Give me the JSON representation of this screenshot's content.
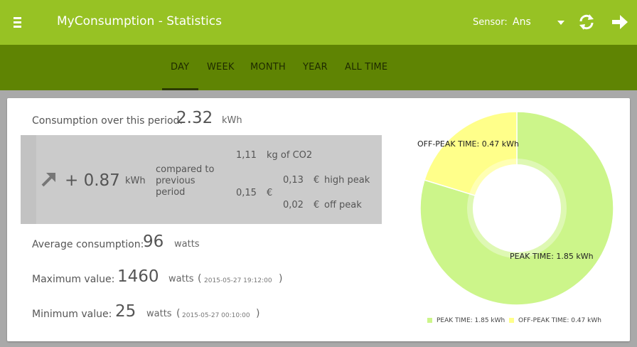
{
  "app": {
    "title": "MyConsumption - Statistics"
  },
  "header": {
    "sensor_label": "Sensor:",
    "sensor_value": "Ans"
  },
  "icons": {
    "menu": "menu-icon",
    "refresh": "refresh-icon",
    "forward": "forward-arrow-icon",
    "trend": "trend-up-arrow-icon"
  },
  "tabs": [
    {
      "label": "DAY",
      "active": true
    },
    {
      "label": "WEEK",
      "active": false
    },
    {
      "label": "MONTH",
      "active": false
    },
    {
      "label": "YEAR",
      "active": false
    },
    {
      "label": "ALL TIME",
      "active": false
    }
  ],
  "stats": {
    "consumption": {
      "label": "Consumption over this period:",
      "value": "2.32",
      "unit": "kWh"
    },
    "comparison": {
      "delta": "+ 0.87",
      "delta_unit": "kWh",
      "compared_line1": "compared to",
      "compared_line2": "previous",
      "compared_line3": "period",
      "co2_value": "1,11",
      "co2_unit": "kg of CO2",
      "cost_total": "0,15",
      "cost_currency": "€",
      "high_peak_value": "0,13",
      "high_peak_currency": "€",
      "high_peak_label": "high peak",
      "off_peak_value": "0,02",
      "off_peak_currency": "€",
      "off_peak_label": "off peak"
    },
    "average": {
      "label": "Average consumption:",
      "value": "96",
      "unit": "watts"
    },
    "maximum": {
      "label": "Maximum value:",
      "value": "1460",
      "unit": "watts",
      "timestamp": "2015-05-27 19:12:00"
    },
    "minimum": {
      "label": "Minimum value:",
      "value": "25",
      "unit": "watts",
      "timestamp": "2015-05-27 00:10:00"
    }
  },
  "chart_data": {
    "type": "pie",
    "categories": [
      "PEAK TIME",
      "OFF-PEAK TIME"
    ],
    "values": [
      1.85,
      0.47
    ],
    "unit": "kWh",
    "slice_labels": [
      "PEAK TIME: 1.85 kWh",
      "OFF-PEAK TIME: 0.47 kWh"
    ],
    "legend": [
      "PEAK TIME: 1.85 kWh",
      "OFF-PEAK TIME: 0.47 kWh"
    ],
    "legend_position": "bottom",
    "donut": true,
    "colors": [
      "#ccf58a",
      "#ffff8a"
    ]
  },
  "colors": {
    "appbar": "#97c224",
    "tabbar": "#5f8403",
    "background": "#a9a9a9"
  }
}
